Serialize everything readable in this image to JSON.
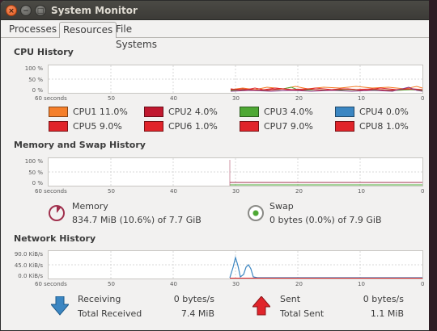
{
  "window": {
    "title": "System Monitor"
  },
  "tabs": [
    {
      "label": "Processes",
      "active": false
    },
    {
      "label": "Resources",
      "active": true
    },
    {
      "label": "File Systems",
      "active": false
    }
  ],
  "cpu": {
    "title": "CPU History",
    "y_labels": [
      "100 %",
      "50 %",
      "0 %"
    ],
    "x_labels": [
      "60 seconds",
      "50",
      "40",
      "30",
      "20",
      "10",
      "0"
    ],
    "cores": [
      {
        "label": "CPU1",
        "value": "11.0%",
        "color": "#f57f2a"
      },
      {
        "label": "CPU2",
        "value": "4.0%",
        "color": "#c0182f"
      },
      {
        "label": "CPU3",
        "value": "4.0%",
        "color": "#4ea834"
      },
      {
        "label": "CPU4",
        "value": "0.0%",
        "color": "#3b86c2"
      },
      {
        "label": "CPU5",
        "value": "9.0%",
        "color": "#e0242a"
      },
      {
        "label": "CPU6",
        "value": "1.0%",
        "color": "#e0242a"
      },
      {
        "label": "CPU7",
        "value": "9.0%",
        "color": "#e0242a"
      },
      {
        "label": "CPU8",
        "value": "1.0%",
        "color": "#e0242a"
      }
    ]
  },
  "memory": {
    "title": "Memory and Swap History",
    "y_labels": [
      "100 %",
      "50 %",
      "0 %"
    ],
    "x_labels": [
      "60 seconds",
      "50",
      "40",
      "30",
      "20",
      "10",
      "0"
    ],
    "memory_label": "Memory",
    "memory_value": "834.7 MiB (10.6%) of 7.7 GiB",
    "memory_percent": 10.6,
    "memory_color": "#a0304d",
    "swap_label": "Swap",
    "swap_value": "0 bytes (0.0%) of 7.9 GiB",
    "swap_percent": 0.0,
    "swap_color": "#4ea834"
  },
  "network": {
    "title": "Network History",
    "y_labels": [
      "90.0 KiB/s",
      "45.0 KiB/s",
      "0.0 KiB/s"
    ],
    "x_labels": [
      "60 seconds",
      "50",
      "40",
      "30",
      "20",
      "10",
      "0"
    ],
    "receiving_label": "Receiving",
    "receiving_value": "0 bytes/s",
    "total_received_label": "Total Received",
    "total_received_value": "7.4 MiB",
    "sent_label": "Sent",
    "sent_value": "0 bytes/s",
    "total_sent_label": "Total Sent",
    "total_sent_value": "1.1 MiB",
    "receive_color": "#3b86c2",
    "sent_color": "#e0242a"
  }
}
